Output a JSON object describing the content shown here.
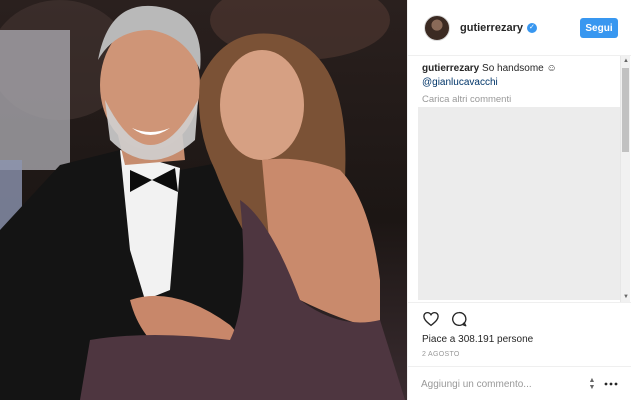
{
  "post": {
    "username": "gutierrezary",
    "verified_icon": "check-icon",
    "follow_label": "Segui",
    "caption_text": "So handsome",
    "caption_emoji": "☺",
    "mention": "@gianlucavacchi",
    "load_more": "Carica altri commenti",
    "likes": "Piace a 308.191 persone",
    "date": "2 AGOSTO",
    "comment_placeholder": "Aggiungi un commento...",
    "icons": [
      "heart-icon",
      "comment-icon",
      "more-options-icon"
    ]
  },
  "colors": {
    "accent": "#3897f0",
    "text": "#262626",
    "muted": "#999999",
    "border": "#efefef"
  }
}
